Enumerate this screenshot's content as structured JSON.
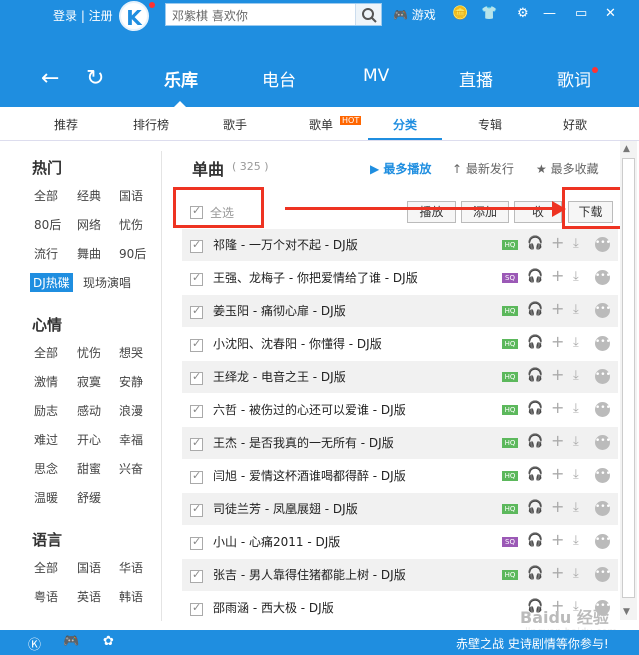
{
  "top": {
    "login": "登录 | 注册",
    "logo": "K",
    "search_placeholder": "邓紫棋 喜欢你",
    "game": "游戏"
  },
  "tabs": [
    "乐库",
    "电台",
    "MV",
    "直播",
    "歌词"
  ],
  "sub": [
    "推荐",
    "排行榜",
    "歌手",
    "歌单",
    "分类",
    "专辑",
    "好歌"
  ],
  "hot_badge": "HOT",
  "left": {
    "hot_title": "热门",
    "hot": [
      "全部",
      "经典",
      "国语",
      "80后",
      "网络",
      "忧伤",
      "流行",
      "舞曲",
      "90后",
      "DJ热碟",
      "现场演唱"
    ],
    "mood_title": "心情",
    "mood": [
      "全部",
      "忧伤",
      "想哭",
      "激情",
      "寂寞",
      "安静",
      "励志",
      "感动",
      "浪漫",
      "难过",
      "开心",
      "幸福",
      "思念",
      "甜蜜",
      "兴奋",
      "温暖",
      "舒缓"
    ],
    "lang_title": "语言",
    "lang": [
      "全部",
      "国语",
      "华语",
      "粤语",
      "英语",
      "韩语"
    ]
  },
  "main": {
    "title": "单曲",
    "count": "( 325 )",
    "sort": [
      "最多播放",
      "最新发行",
      "最多收藏"
    ],
    "select_all": "全选",
    "buttons": [
      "播放",
      "添加",
      "收",
      "下载"
    ]
  },
  "songs": [
    {
      "t": "祁隆 - 一万个对不起 - DJ版",
      "q": "HQ"
    },
    {
      "t": "王强、龙梅子 - 你把爱情给了谁 - DJ版",
      "q": "SQ"
    },
    {
      "t": "姜玉阳 - 痛彻心扉 - DJ版",
      "q": "HQ"
    },
    {
      "t": "小沈阳、沈春阳 - 你懂得 - DJ版",
      "q": "HQ"
    },
    {
      "t": "王绎龙 - 电音之王 - DJ版",
      "q": "HQ"
    },
    {
      "t": "六哲 - 被伤过的心还可以爱谁 - DJ版",
      "q": "HQ"
    },
    {
      "t": "王杰 - 是否我真的一无所有 - DJ版",
      "q": "HQ"
    },
    {
      "t": "闫旭 - 爱情这杯酒谁喝都得醉 - DJ版",
      "q": "HQ"
    },
    {
      "t": "司徒兰芳 - 凤凰展翅 - DJ版",
      "q": "HQ"
    },
    {
      "t": "小山 - 心痛2011 - DJ版",
      "q": "SQ"
    },
    {
      "t": "张吉 - 男人靠得住猪都能上树 - DJ版",
      "q": "HQ"
    },
    {
      "t": "邵雨涵 - 西大极 - DJ版",
      "q": ""
    }
  ],
  "bottom": {
    "ad": "赤壁之战 史诗剧情等你参与!"
  },
  "watermark": "Baidu 经验",
  "watermark_url": "jingyan.baidu.com"
}
